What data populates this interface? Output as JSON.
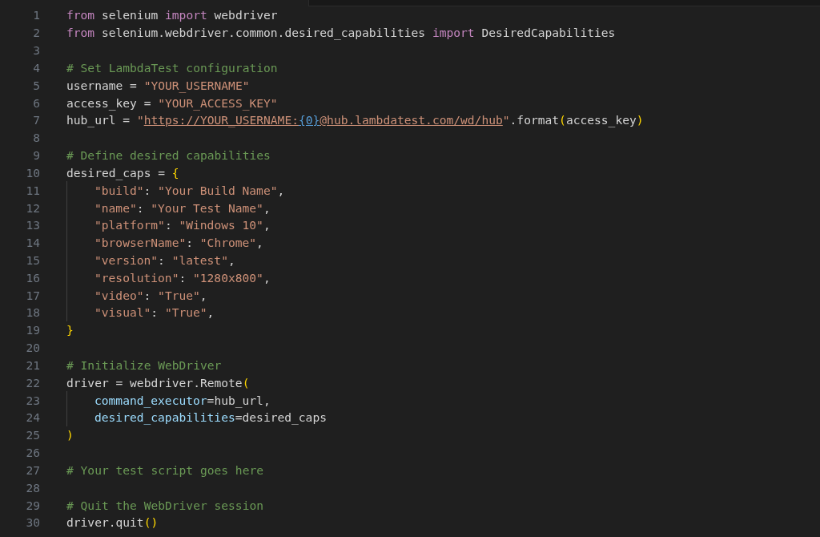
{
  "editor": {
    "lines": [
      {
        "number": "1",
        "tokens": [
          {
            "kind": "keyword",
            "text": "from"
          },
          {
            "kind": "plain",
            "text": " selenium "
          },
          {
            "kind": "keyword",
            "text": "import"
          },
          {
            "kind": "plain",
            "text": " webdriver"
          }
        ]
      },
      {
        "number": "2",
        "tokens": [
          {
            "kind": "keyword",
            "text": "from"
          },
          {
            "kind": "plain",
            "text": " selenium.webdriver.common.desired_capabilities "
          },
          {
            "kind": "keyword",
            "text": "import"
          },
          {
            "kind": "plain",
            "text": " DesiredCapabilities"
          }
        ]
      },
      {
        "number": "3"
      },
      {
        "number": "4",
        "tokens": [
          {
            "kind": "comment",
            "text": "# Set LambdaTest configuration"
          }
        ]
      },
      {
        "number": "5",
        "tokens": [
          {
            "kind": "plain",
            "text": "username = "
          },
          {
            "kind": "string",
            "text": "\"YOUR_USERNAME\""
          }
        ]
      },
      {
        "number": "6",
        "tokens": [
          {
            "kind": "plain",
            "text": "access_key = "
          },
          {
            "kind": "string",
            "text": "\"YOUR_ACCESS_KEY\""
          }
        ]
      },
      {
        "number": "7",
        "tokens": [
          {
            "kind": "plain",
            "text": "hub_url = "
          },
          {
            "kind": "string",
            "text": "\""
          },
          {
            "kind": "link",
            "text": "https://YOUR_USERNAME:"
          },
          {
            "kind": "placeholder",
            "text": "{0}"
          },
          {
            "kind": "link",
            "text": "@hub.lambdatest.com/wd/hub"
          },
          {
            "kind": "string",
            "text": "\""
          },
          {
            "kind": "plain",
            "text": ".format"
          },
          {
            "kind": "bracket",
            "text": "("
          },
          {
            "kind": "plain",
            "text": "access_key"
          },
          {
            "kind": "bracket",
            "text": ")"
          }
        ]
      },
      {
        "number": "8"
      },
      {
        "number": "9",
        "tokens": [
          {
            "kind": "comment",
            "text": "# Define desired capabilities"
          }
        ]
      },
      {
        "number": "10",
        "tokens": [
          {
            "kind": "plain",
            "text": "desired_caps = "
          },
          {
            "kind": "bracket",
            "text": "{"
          }
        ]
      },
      {
        "number": "11",
        "indented": true,
        "tokens": [
          {
            "kind": "string",
            "text": "\"build\""
          },
          {
            "kind": "plain",
            "text": ": "
          },
          {
            "kind": "string",
            "text": "\"Your Build Name\""
          },
          {
            "kind": "plain",
            "text": ","
          }
        ]
      },
      {
        "number": "12",
        "indented": true,
        "tokens": [
          {
            "kind": "string",
            "text": "\"name\""
          },
          {
            "kind": "plain",
            "text": ": "
          },
          {
            "kind": "string",
            "text": "\"Your Test Name\""
          },
          {
            "kind": "plain",
            "text": ","
          }
        ]
      },
      {
        "number": "13",
        "indented": true,
        "tokens": [
          {
            "kind": "string",
            "text": "\"platform\""
          },
          {
            "kind": "plain",
            "text": ": "
          },
          {
            "kind": "string",
            "text": "\"Windows 10\""
          },
          {
            "kind": "plain",
            "text": ","
          }
        ]
      },
      {
        "number": "14",
        "indented": true,
        "tokens": [
          {
            "kind": "string",
            "text": "\"browserName\""
          },
          {
            "kind": "plain",
            "text": ": "
          },
          {
            "kind": "string",
            "text": "\"Chrome\""
          },
          {
            "kind": "plain",
            "text": ","
          }
        ]
      },
      {
        "number": "15",
        "indented": true,
        "tokens": [
          {
            "kind": "string",
            "text": "\"version\""
          },
          {
            "kind": "plain",
            "text": ": "
          },
          {
            "kind": "string",
            "text": "\"latest\""
          },
          {
            "kind": "plain",
            "text": ","
          }
        ]
      },
      {
        "number": "16",
        "indented": true,
        "tokens": [
          {
            "kind": "string",
            "text": "\"resolution\""
          },
          {
            "kind": "plain",
            "text": ": "
          },
          {
            "kind": "string",
            "text": "\"1280x800\""
          },
          {
            "kind": "plain",
            "text": ","
          }
        ]
      },
      {
        "number": "17",
        "indented": true,
        "tokens": [
          {
            "kind": "string",
            "text": "\"video\""
          },
          {
            "kind": "plain",
            "text": ": "
          },
          {
            "kind": "string",
            "text": "\"True\""
          },
          {
            "kind": "plain",
            "text": ","
          }
        ]
      },
      {
        "number": "18",
        "indented": true,
        "tokens": [
          {
            "kind": "string",
            "text": "\"visual\""
          },
          {
            "kind": "plain",
            "text": ": "
          },
          {
            "kind": "string",
            "text": "\"True\""
          },
          {
            "kind": "plain",
            "text": ","
          }
        ]
      },
      {
        "number": "19",
        "tokens": [
          {
            "kind": "bracket",
            "text": "}"
          }
        ]
      },
      {
        "number": "20"
      },
      {
        "number": "21",
        "tokens": [
          {
            "kind": "comment",
            "text": "# Initialize WebDriver"
          }
        ]
      },
      {
        "number": "22",
        "tokens": [
          {
            "kind": "plain",
            "text": "driver = webdriver.Remote"
          },
          {
            "kind": "bracket",
            "text": "("
          }
        ]
      },
      {
        "number": "23",
        "indented": true,
        "tokens": [
          {
            "kind": "parameter",
            "text": "command_executor"
          },
          {
            "kind": "plain",
            "text": "=hub_url,"
          }
        ]
      },
      {
        "number": "24",
        "indented": true,
        "tokens": [
          {
            "kind": "parameter",
            "text": "desired_capabilities"
          },
          {
            "kind": "plain",
            "text": "=desired_caps"
          }
        ]
      },
      {
        "number": "25",
        "tokens": [
          {
            "kind": "bracket",
            "text": ")"
          }
        ]
      },
      {
        "number": "26"
      },
      {
        "number": "27",
        "tokens": [
          {
            "kind": "comment",
            "text": "# Your test script goes here"
          }
        ]
      },
      {
        "number": "28"
      },
      {
        "number": "29",
        "tokens": [
          {
            "kind": "comment",
            "text": "# Quit the WebDriver session"
          }
        ]
      },
      {
        "number": "30",
        "tokens": [
          {
            "kind": "plain",
            "text": "driver.quit"
          },
          {
            "kind": "bracket",
            "text": "()"
          }
        ]
      }
    ]
  }
}
